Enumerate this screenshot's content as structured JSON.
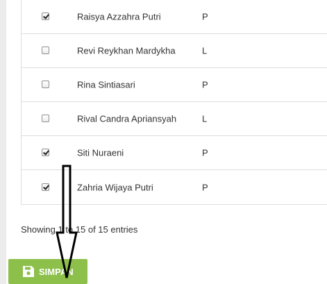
{
  "students": [
    {
      "name": "Raisya Azzahra Putri",
      "gender": "P",
      "checked": true
    },
    {
      "name": "Revi Reykhan Mardykha",
      "gender": "L",
      "checked": false
    },
    {
      "name": "Rina Sintiasari",
      "gender": "P",
      "checked": false
    },
    {
      "name": "Rival Candra Apriansyah",
      "gender": "L",
      "checked": false
    },
    {
      "name": "Siti Nuraeni",
      "gender": "P",
      "checked": true
    },
    {
      "name": "Zahria Wijaya Putri",
      "gender": "P",
      "checked": true
    }
  ],
  "table_info": "Showing 1 to 15 of 15 entries",
  "save_button": {
    "label": "SIMPAN",
    "icon": "floppy-disk-icon"
  },
  "colors": {
    "button": "#8dc04b",
    "annotation": "#000000"
  }
}
